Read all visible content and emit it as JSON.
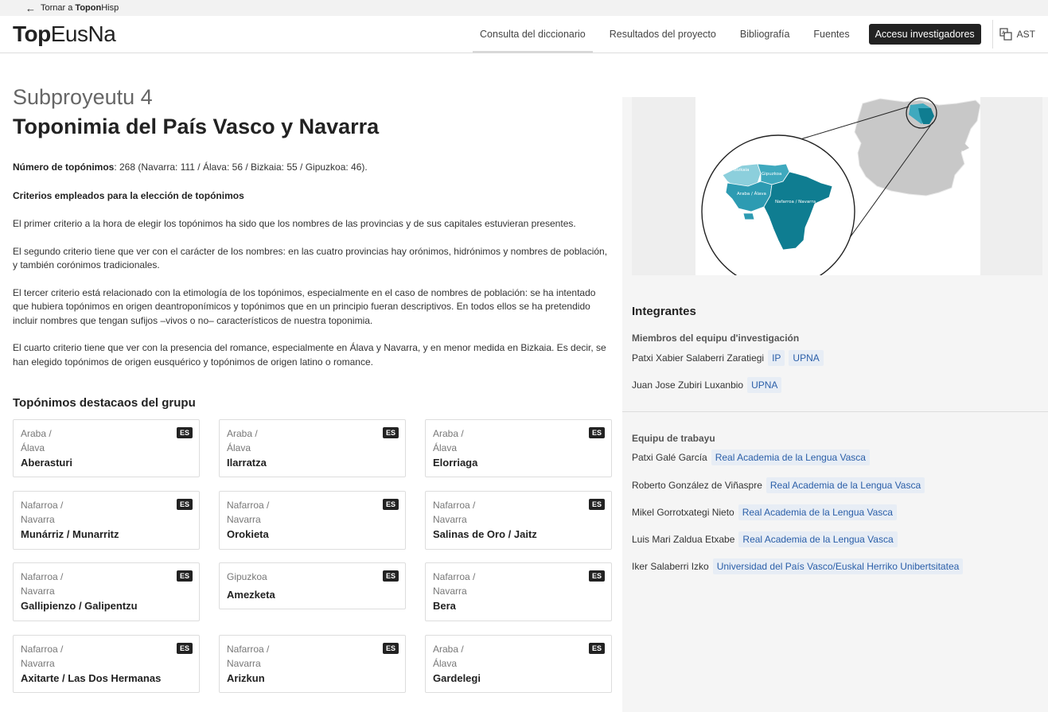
{
  "topbar": {
    "back_prefix": "Tornar a",
    "back_bold": "Topon",
    "back_suffix": "Hisp"
  },
  "logo": {
    "bold": "Top",
    "regular": "EusNa"
  },
  "nav": {
    "items": [
      "Consulta del diccionario",
      "Resultados del proyecto",
      "Bibliografía",
      "Fuentes"
    ],
    "researchers_button": "Accesu investigadores",
    "language": "AST"
  },
  "page": {
    "subtitle": "Subproyeutu 4",
    "title": "Toponimia del País Vasco y Navarra",
    "count_label": "Número de topónimos",
    "count_text": ": 268 (Navarra: 111 / Álava: 56 / Bizkaia: 55 / Gipuzkoa: 46).",
    "criteria_heading": "Criterios empleados para la elección de topónimos",
    "p1": "El primer criterio a la hora de elegir los topónimos ha sido que los nombres de las provincias y de sus capitales estuvieran presentes.",
    "p2": "El segundo criterio tiene que ver con el carácter de los nombres: en las cuatro provincias hay orónimos, hidrónimos y nombres de población, y también corónimos tradicionales.",
    "p3": "El tercer criterio está relacionado con la etimología de los topónimos, especialmente en el caso de nombres de población: se ha intentado que hubiera topónimos en origen deantroponímicos y topónimos que en un principio fueran descriptivos. En todos ellos se ha pretendido incluir nombres que tengan sufijos –vivos o no– característicos de nuestra toponimia.",
    "p4": "El cuarto criterio tiene que ver con la presencia del romance, especialmente en Álava y Navarra, y en menor medida en Bizkaia. Es decir, se han elegido topónimos de origen eusquérico y topónimos de origen latino o romance.",
    "featured_heading": "Topónimos destacaos del grupu"
  },
  "cards": [
    {
      "r1": "Araba /",
      "r2": "Álava",
      "name": "Aberasturi",
      "tag": "ES"
    },
    {
      "r1": "Araba /",
      "r2": "Álava",
      "name": "Ilarratza",
      "tag": "ES"
    },
    {
      "r1": "Araba /",
      "r2": "Álava",
      "name": "Elorriaga",
      "tag": "ES"
    },
    {
      "r1": "Nafarroa /",
      "r2": "Navarra",
      "name": "Munárriz / Munarritz",
      "tag": "ES"
    },
    {
      "r1": "Nafarroa /",
      "r2": "Navarra",
      "name": "Orokieta",
      "tag": "ES"
    },
    {
      "r1": "Nafarroa /",
      "r2": "Navarra",
      "name": "Salinas de Oro / Jaitz",
      "tag": "ES"
    },
    {
      "r1": "Nafarroa /",
      "r2": "Navarra",
      "name": "Gallipienzo / Galipentzu",
      "tag": "ES"
    },
    {
      "r1": "Gipuzkoa",
      "r2": "",
      "name": "Amezketa",
      "tag": "ES"
    },
    {
      "r1": "Nafarroa /",
      "r2": "Navarra",
      "name": "Bera",
      "tag": "ES"
    },
    {
      "r1": "Nafarroa /",
      "r2": "Navarra",
      "name": "Axitarte / Las Dos Hermanas",
      "tag": "ES"
    },
    {
      "r1": "Nafarroa /",
      "r2": "Navarra",
      "name": "Arizkun",
      "tag": "ES"
    },
    {
      "r1": "Araba /",
      "r2": "Álava",
      "name": "Gardelegi",
      "tag": "ES"
    }
  ],
  "map": {
    "labels": {
      "bizkaia": "Bizkaia",
      "gipuzkoa": "Gipuzkoa",
      "araba": "Araba / Álava",
      "nafarroa": "Nafarroa / Navarra"
    },
    "colors": {
      "bizkaia": "#8ccfdc",
      "gipuzkoa": "#3fa9be",
      "araba": "#2d9bb2",
      "nafarroa": "#0f7d91",
      "spain": "#c8c8c8"
    }
  },
  "members": {
    "heading": "Integrantes",
    "research_heading": "Miembros del equipu d'investigación",
    "research": [
      {
        "name": "Patxi Xabier Salaberri Zaratiegi",
        "tags": [
          "IP",
          "UPNA"
        ]
      },
      {
        "name": "Juan Jose Zubiri Luxanbio",
        "tags": [
          "UPNA"
        ]
      }
    ],
    "work_heading": "Equipu de trabayu",
    "work": [
      {
        "name": "Patxi Galé García",
        "tags": [
          "Real Academia de la Lengua Vasca"
        ]
      },
      {
        "name": "Roberto González de Viñaspre",
        "tags": [
          "Real Academia de la Lengua Vasca"
        ]
      },
      {
        "name": "Mikel Gorrotxategi Nieto",
        "tags": [
          "Real Academia de la Lengua Vasca"
        ]
      },
      {
        "name": "Luis Mari Zaldua Etxabe",
        "tags": [
          "Real Academia de la Lengua Vasca"
        ]
      },
      {
        "name": "Iker Salaberri Izko",
        "tags": [
          "Universidad del País Vasco/Euskal Herriko Unibertsitatea"
        ]
      }
    ]
  }
}
